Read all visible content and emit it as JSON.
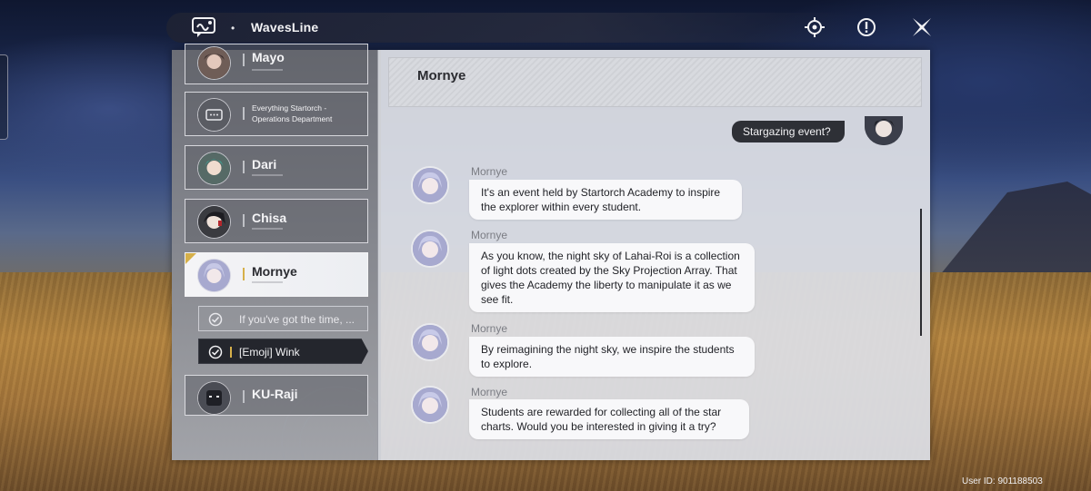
{
  "app": {
    "title": "WavesLine",
    "icons": [
      "waves-line-chat-icon",
      "target-icon",
      "alert-icon",
      "close-icon"
    ]
  },
  "contacts": [
    {
      "name": "Mayo"
    },
    {
      "name": "Everything Startorch - Operations Department"
    },
    {
      "name": "Dari"
    },
    {
      "name": "Chisa"
    },
    {
      "name": "Mornye",
      "active": true
    },
    {
      "name": "KU-Raji"
    }
  ],
  "replies": [
    {
      "text": "If you've got the time, ...",
      "state": "sent"
    },
    {
      "text": "[Emoji] Wink",
      "state": "selected"
    }
  ],
  "chat": {
    "title": "Mornye",
    "outgoing": "Stargazing event?",
    "messages": [
      {
        "sender": "Mornye",
        "text": "It's an event held by Startorch Academy to inspire the explorer within every student."
      },
      {
        "sender": "Mornye",
        "text": "As you know, the night sky of Lahai-Roi is a collection of light dots created by the Sky Projection Array. That gives the Academy the liberty to manipulate it as we see fit."
      },
      {
        "sender": "Mornye",
        "text": "By reimagining the night sky, we inspire the students to explore."
      },
      {
        "sender": "Mornye",
        "text": "Students are rewarded for collecting all of the star charts. Would you be interested in giving it a try?"
      }
    ]
  },
  "footer": {
    "user_id": "User ID: 901188503"
  },
  "colors": {
    "accent": "#d6b04a",
    "panel": "#dcdee4",
    "dark": "#2e3036"
  }
}
